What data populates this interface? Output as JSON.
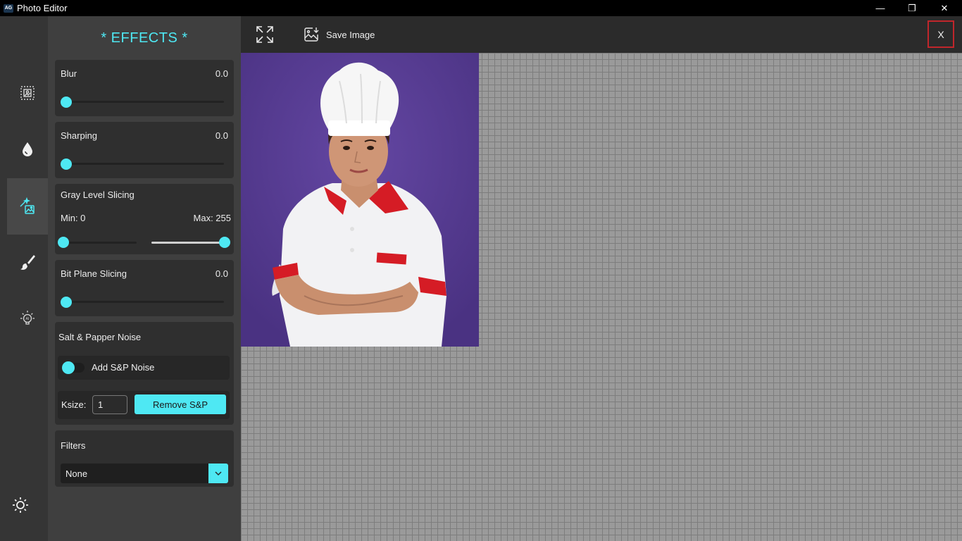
{
  "window": {
    "app_icon_text": "AG",
    "title": "Photo Editor",
    "minimize_glyph": "—",
    "maximize_glyph": "❐",
    "close_glyph": "✕"
  },
  "rail": {
    "items": [
      {
        "icon": "crop-frame-icon"
      },
      {
        "icon": "water-drop-icon"
      },
      {
        "icon": "effects-wand-icon",
        "active": true
      },
      {
        "icon": "brush-icon"
      },
      {
        "icon": "ai-bulb-icon"
      },
      {
        "icon": "brightness-sun-icon"
      }
    ]
  },
  "effects": {
    "title": "* EFFECTS *",
    "blur": {
      "label": "Blur",
      "value": "0.0"
    },
    "sharping": {
      "label": "Sharping",
      "value": "0.0"
    },
    "gray_level": {
      "label": "Gray Level Slicing",
      "min_label": "Min: 0",
      "max_label": "Max: 255"
    },
    "bit_plane": {
      "label": "Bit Plane Slicing",
      "value": "0.0"
    },
    "salt_pepper": {
      "label": "Salt & Papper Noise",
      "toggle_label": "Add S&P Noise",
      "ksize_label": "Ksize:",
      "ksize_value": "1",
      "remove_button": "Remove S&P"
    },
    "filters": {
      "label": "Filters",
      "selected": "None"
    }
  },
  "toolbar": {
    "expand_icon": "expand-arrows-icon",
    "save_label": "Save Image",
    "close_label": "X"
  },
  "colors": {
    "accent": "#4ee8f3",
    "panel": "#3f3f3f",
    "card": "#2f2f2f",
    "rail": "#353535",
    "close_border": "#c0262b",
    "photo_background": "#5a3f94"
  }
}
